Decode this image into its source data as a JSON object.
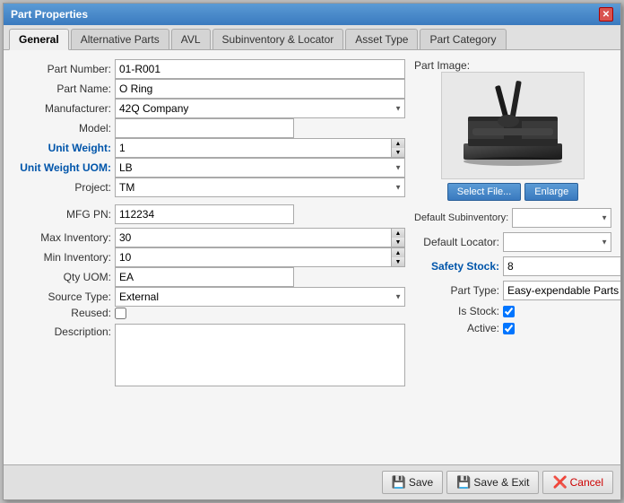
{
  "window": {
    "title": "Part Properties"
  },
  "tabs": [
    {
      "id": "general",
      "label": "General",
      "active": true
    },
    {
      "id": "alt-parts",
      "label": "Alternative Parts",
      "active": false
    },
    {
      "id": "avl",
      "label": "AVL",
      "active": false
    },
    {
      "id": "subinv",
      "label": "Subinventory & Locator",
      "active": false
    },
    {
      "id": "asset",
      "label": "Asset Type",
      "active": false
    },
    {
      "id": "part-cat",
      "label": "Part Category",
      "active": false
    }
  ],
  "form": {
    "part_number_label": "Part Number:",
    "part_number_value": "01-R001",
    "part_name_label": "Part Name:",
    "part_name_value": "O Ring",
    "manufacturer_label": "Manufacturer:",
    "manufacturer_value": "42Q Company",
    "model_label": "Model:",
    "model_value": "",
    "unit_weight_label": "Unit Weight:",
    "unit_weight_value": "1",
    "unit_weight_uom_label": "Unit Weight UOM:",
    "unit_weight_uom_value": "LB",
    "project_label": "Project:",
    "project_value": "TM",
    "mfg_pn_label": "MFG PN:",
    "mfg_pn_value": "112234",
    "max_inventory_label": "Max Inventory:",
    "max_inventory_value": "30",
    "min_inventory_label": "Min Inventory:",
    "min_inventory_value": "10",
    "qty_uom_label": "Qty UOM:",
    "qty_uom_value": "EA",
    "source_type_label": "Source Type:",
    "source_type_value": "External",
    "reused_label": "Reused:",
    "description_label": "Description:",
    "description_value": "",
    "part_image_label": "Part Image:",
    "select_file_label": "Select File...",
    "enlarge_label": "Enlarge",
    "default_subinventory_label": "Default Subinventory:",
    "default_subinventory_value": "",
    "default_locator_label": "Default Locator:",
    "default_locator_value": "",
    "safety_stock_label": "Safety Stock:",
    "safety_stock_value": "8",
    "part_type_label": "Part Type:",
    "part_type_value": "Easy-expendable Parts",
    "is_stock_label": "Is Stock:",
    "active_label": "Active:"
  },
  "footer": {
    "save_label": "Save",
    "save_exit_label": "Save & Exit",
    "cancel_label": "Cancel"
  }
}
